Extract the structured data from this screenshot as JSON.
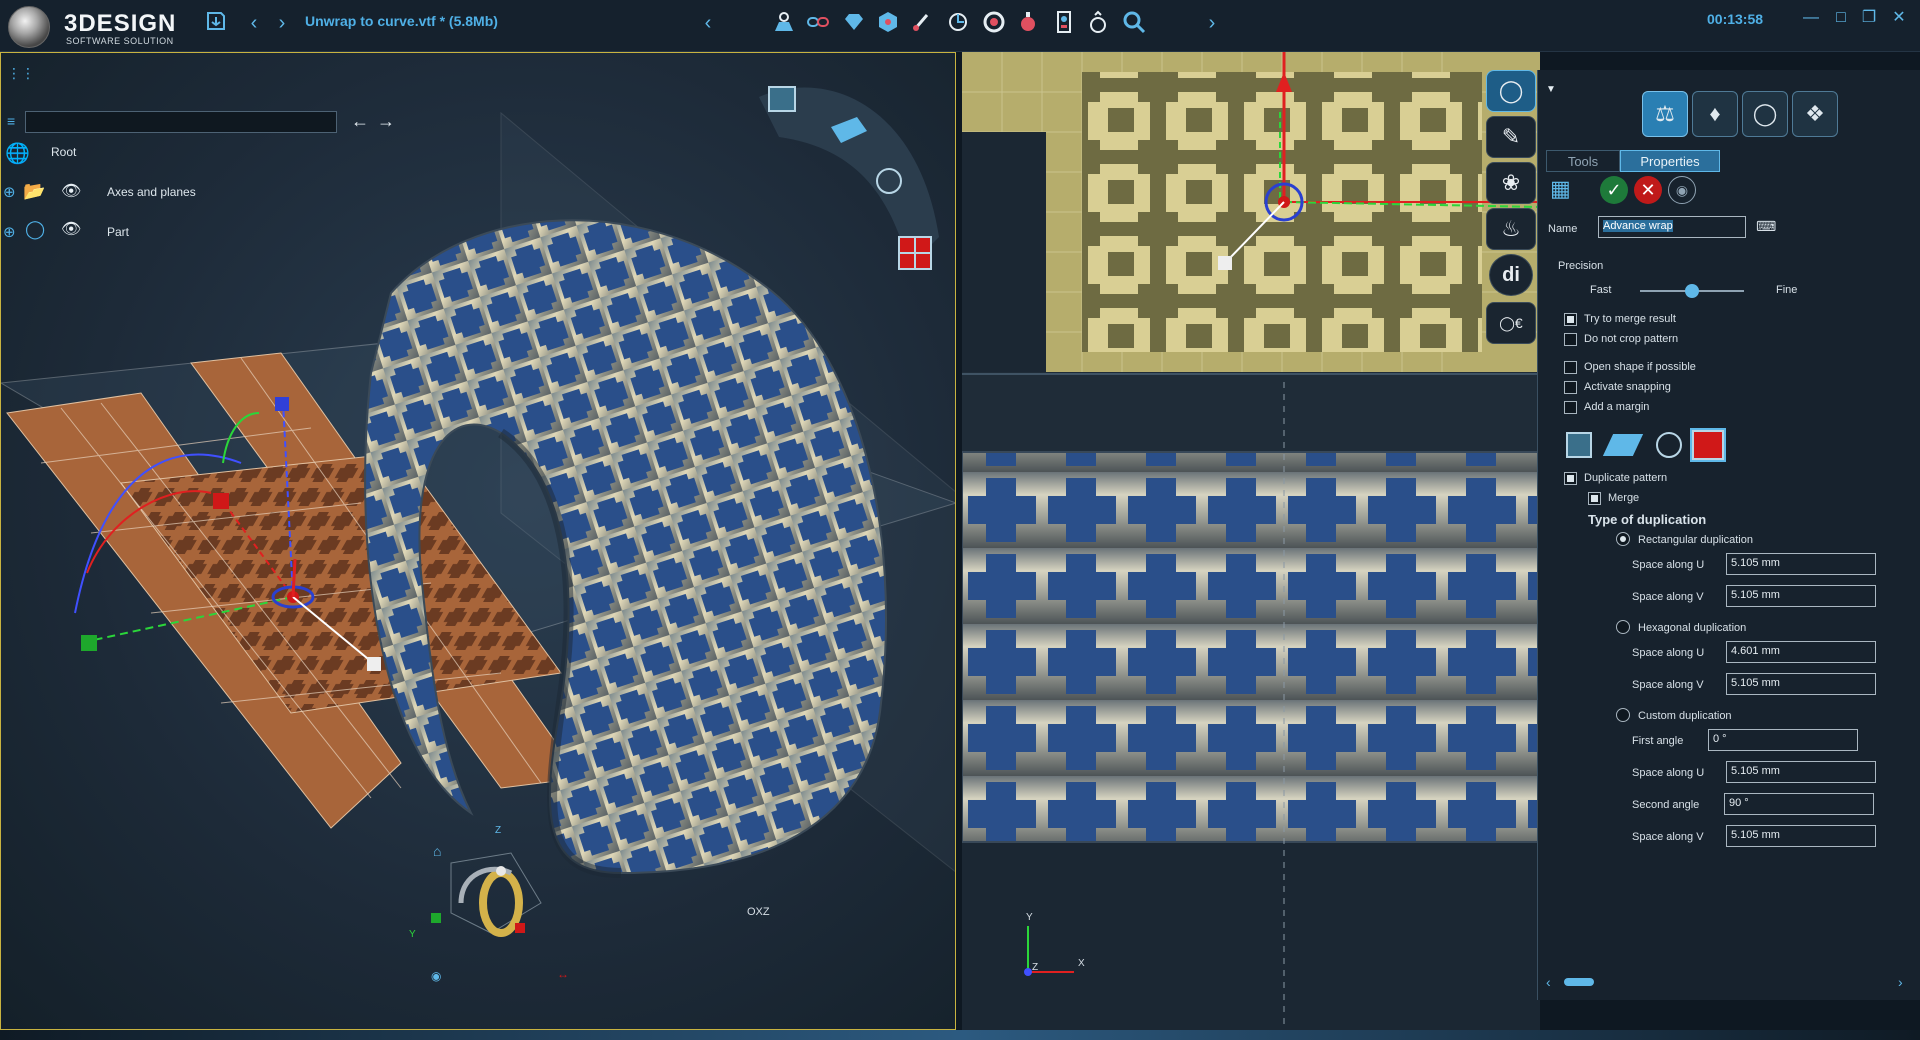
{
  "app": {
    "logo_brand": "3DESIGN",
    "logo_sub": "SOFTWARE SOLUTION",
    "document_title": "Unwrap to curve.vtf * (5.8Mb)",
    "timer": "00:13:58"
  },
  "toolbar": {
    "icons": [
      "save-icon",
      "back-icon",
      "forward-icon",
      "collapse-left-icon",
      "sculpt-icon",
      "link-icon",
      "gem-icon",
      "box-icon",
      "brush-icon",
      "rotate-icon",
      "magnet-icon",
      "ball-icon",
      "meter-icon",
      "ring-measure-icon",
      "zoom-icon",
      "expand-right-icon"
    ]
  },
  "scene_tree": {
    "search_placeholder": "",
    "root_label": "Root",
    "items": [
      {
        "label": "Axes and planes"
      },
      {
        "label": "Part"
      }
    ]
  },
  "viewport_left": {
    "plane_label": "OXZ",
    "axis_labels": {
      "z": "Z",
      "y": "Y"
    }
  },
  "viewport_right": {
    "axis_labels": {
      "y": "Y",
      "z": "Z",
      "x": "X"
    }
  },
  "panel": {
    "tabs": [
      {
        "label": "Tools",
        "active": false
      },
      {
        "label": "Properties",
        "active": true
      }
    ],
    "name_label": "Name",
    "name_value": "Advance wrap",
    "precision_label": "Precision",
    "precision_fast": "Fast",
    "precision_fine": "Fine",
    "precision_value": 0.5,
    "options": [
      {
        "label": "Try to merge result",
        "checked": true
      },
      {
        "label": "Do not crop pattern",
        "checked": false
      },
      {
        "label": "Open shape if possible",
        "checked": false
      },
      {
        "label": "Activate snapping",
        "checked": false
      },
      {
        "label": "Add a margin",
        "checked": false
      }
    ],
    "duplicate_label": "Duplicate pattern",
    "duplicate_checked": true,
    "merge_label": "Merge",
    "merge_checked": true,
    "type_title": "Type of duplication",
    "rect": {
      "label": "Rectangular duplication",
      "selected": true,
      "space_u_label": "Space along U",
      "space_u": "5.105 mm",
      "space_v_label": "Space along V",
      "space_v": "5.105 mm"
    },
    "hex": {
      "label": "Hexagonal duplication",
      "selected": false,
      "space_u_label": "Space along U",
      "space_u": "4.601 mm",
      "space_v_label": "Space along V",
      "space_v": "5.105 mm"
    },
    "custom": {
      "label": "Custom duplication",
      "selected": false,
      "first_angle_label": "First angle",
      "first_angle": "0 °",
      "space_u_label": "Space along U",
      "space_u": "5.105 mm",
      "second_angle_label": "Second angle",
      "second_angle": "90 °",
      "space_v_label": "Space along V",
      "space_v": "5.105 mm"
    }
  },
  "colors": {
    "accent": "#4fb0e6",
    "viewport_border": "#c8b340",
    "metal_blue": "#2a4f8a",
    "ochre": "#c8bd7a",
    "copper": "#b0683c"
  }
}
